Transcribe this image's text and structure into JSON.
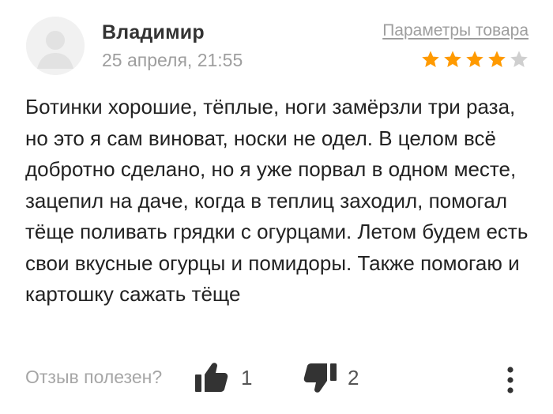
{
  "review": {
    "author": "Владимир",
    "date": "25 апреля, 21:55",
    "params_link": "Параметры товара",
    "rating": 4,
    "rating_max": 5,
    "text": "Ботинки хорошие, тёплые, ноги замёрзли три раза, но это я сам виноват, носки не одел. В целом всё добротно сделано, но я уже порвал в одном месте, зацепил на даче, когда в теплиц заходил, помогал тёще поливать грядки с огурцами. Летом будем есть свои вкусные огурцы и помидоры. Также помогаю и картошку сажать тёще"
  },
  "footer": {
    "helpful_label": "Отзыв полезен?",
    "likes": "1",
    "dislikes": "2"
  },
  "icons": {
    "avatar": "user-avatar-icon",
    "star": "star-icon",
    "like": "thumbs-up-icon",
    "dislike": "thumbs-down-icon",
    "more": "more-vertical-icon"
  },
  "colors": {
    "star_filled": "#ff9a00",
    "star_empty": "#cfcfcf",
    "muted_text": "#9e9e9e",
    "icon_dark": "#333333"
  }
}
